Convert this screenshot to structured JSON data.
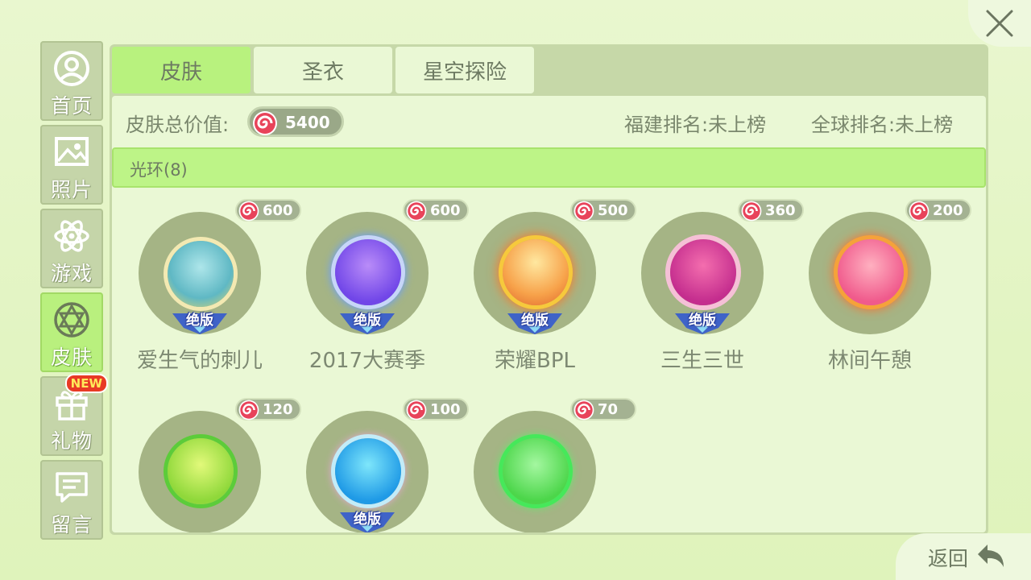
{
  "sidebar": {
    "items": [
      {
        "label": "首页",
        "icon": "user-icon"
      },
      {
        "label": "照片",
        "icon": "photo-icon"
      },
      {
        "label": "游戏",
        "icon": "atom-icon"
      },
      {
        "label": "皮肤",
        "icon": "skin-icon"
      },
      {
        "label": "礼物",
        "icon": "gift-icon"
      },
      {
        "label": "留言",
        "icon": "message-icon"
      }
    ],
    "active_index": 3,
    "new_badge": "NEW"
  },
  "tabs": [
    {
      "label": "皮肤"
    },
    {
      "label": "圣衣"
    },
    {
      "label": "星空探险"
    }
  ],
  "stats": {
    "total_label": "皮肤总价值:",
    "total_value": "5400",
    "fujian_rank": "福建排名:未上榜",
    "global_rank": "全球排名:未上榜"
  },
  "section": {
    "title": "光环(8)"
  },
  "items": [
    {
      "name": "爱生气的刺儿",
      "price": "600",
      "badge": "绝版"
    },
    {
      "name": "2017大赛季",
      "price": "600",
      "badge": "绝版"
    },
    {
      "name": "荣耀BPL",
      "price": "500",
      "badge": "绝版"
    },
    {
      "name": "三生三世",
      "price": "360",
      "badge": "绝版"
    },
    {
      "name": "林间午憩",
      "price": "200",
      "badge": ""
    },
    {
      "name": "",
      "price": "120",
      "badge": ""
    },
    {
      "name": "",
      "price": "100",
      "badge": "绝版"
    },
    {
      "name": "",
      "price": "70",
      "badge": ""
    }
  ],
  "back": {
    "label": "返回"
  },
  "colors": {
    "background": "#e4f5c4",
    "active_green": "#b8f27e",
    "panel": "#c6d8a8",
    "coin_red": "#e8435a",
    "badge_blue": "#3f63c8"
  }
}
